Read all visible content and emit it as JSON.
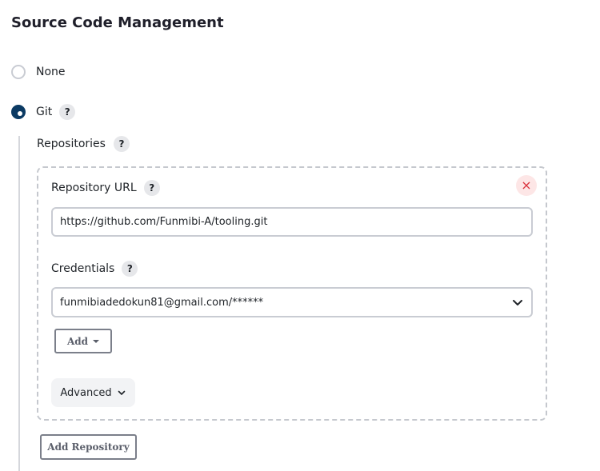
{
  "section": {
    "title": "Source Code Management"
  },
  "scm_options": [
    {
      "label": "None",
      "selected": false
    },
    {
      "label": "Git",
      "selected": true,
      "help": "?"
    }
  ],
  "git": {
    "repositories_label": "Repositories",
    "repositories_help": "?",
    "repository": {
      "remove_icon": "×",
      "url_label": "Repository URL",
      "url_help": "?",
      "url_value": "https://github.com/Funmibi-A/tooling.git",
      "credentials_label": "Credentials",
      "credentials_help": "?",
      "credentials_value": "funmibiadedokun81@gmail.com/******",
      "add_button": "Add",
      "advanced_button": "Advanced"
    },
    "add_repository_button": "Add Repository"
  },
  "colors": {
    "accent": "#0b3a63",
    "danger": "#d9313c",
    "border": "#c9ccd3"
  }
}
